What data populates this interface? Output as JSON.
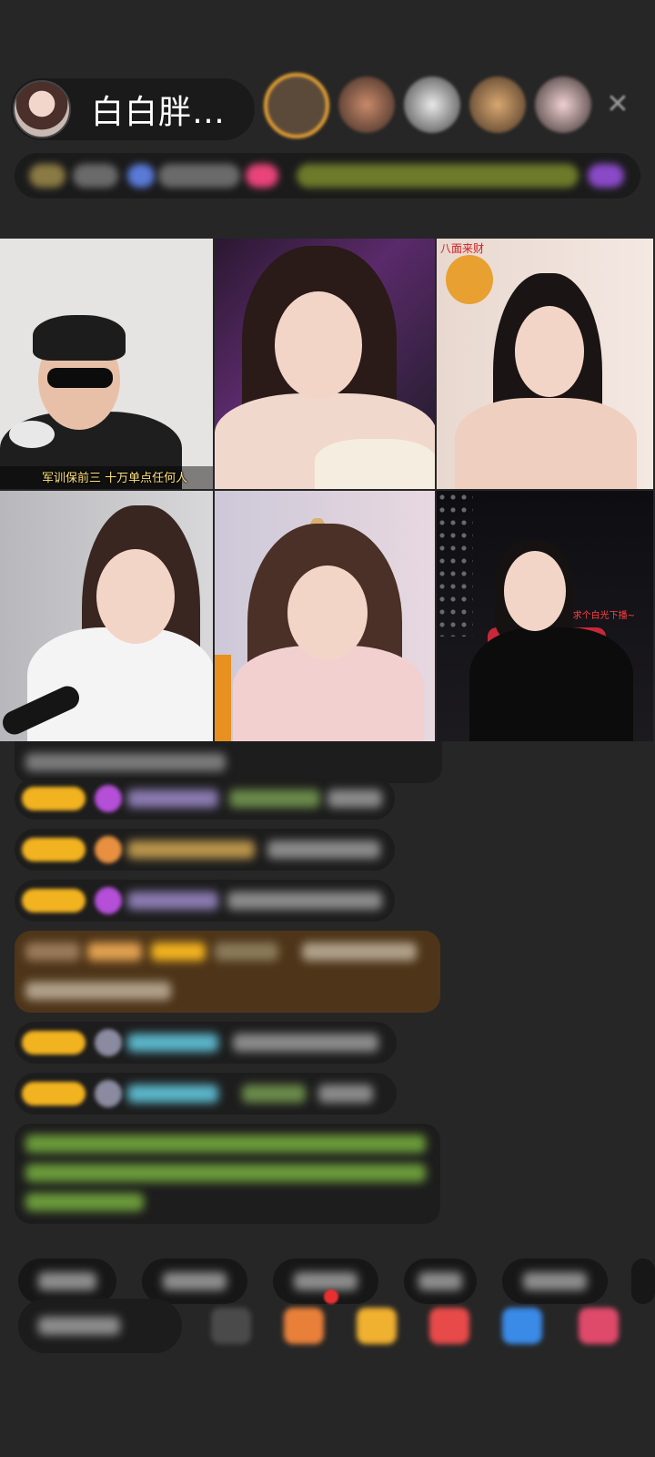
{
  "host": {
    "name": "白白胖…"
  },
  "viewers": [
    {
      "name": "viewer-avatar-1"
    },
    {
      "name": "viewer-avatar-2"
    },
    {
      "name": "viewer-avatar-3"
    },
    {
      "name": "viewer-avatar-4"
    },
    {
      "name": "viewer-avatar-5"
    }
  ],
  "close_glyph": "✕",
  "grid": {
    "tiles": [
      {
        "caption": "军训保前三 十万单点任何人"
      },
      {
        "caption": ""
      },
      {
        "banner": "八面来财"
      },
      {
        "caption": ""
      },
      {
        "caption": ""
      },
      {
        "caption": "求个白光下播~"
      }
    ]
  },
  "colors": {
    "background": "#262626",
    "pill": "#1a1a1a",
    "gold_badge": "#f2b320",
    "purple_gem": "#b54fd8",
    "gift_banner": "#5a3d1c",
    "system_text": "#7fb83a",
    "name_teal": "#5ab4c8"
  },
  "icons": {
    "close": "close-icon",
    "chat_input": "chat-input",
    "toolbar": [
      "grid-icon",
      "gift-box-icon",
      "gift-bag-icon",
      "heart-icon",
      "share-icon",
      "more-icon"
    ]
  }
}
